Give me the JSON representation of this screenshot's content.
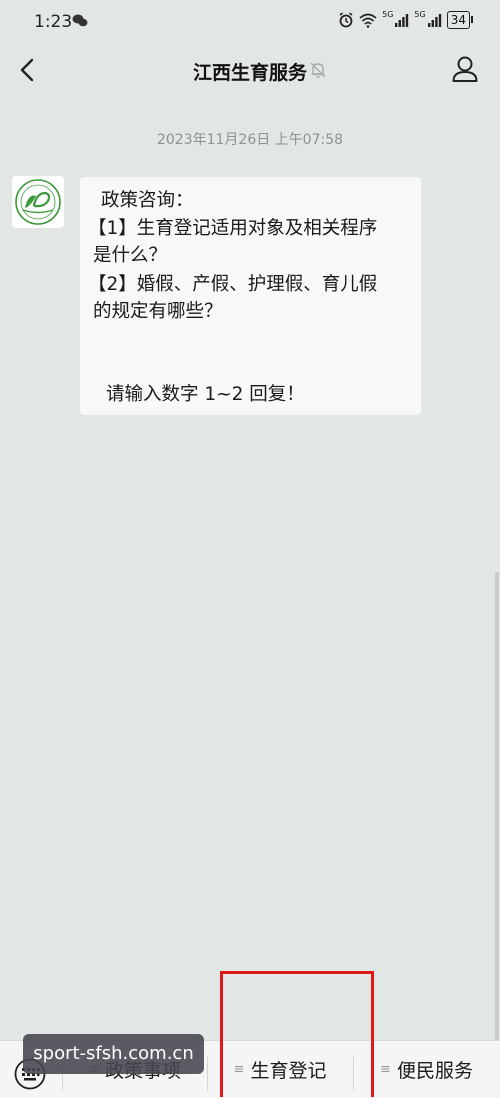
{
  "status_bar": {
    "time": "1:23",
    "signal_1": "5G",
    "signal_2": "5G",
    "battery": "34"
  },
  "nav": {
    "title": "江西生育服务"
  },
  "chat": {
    "timestamp": "2023年11月26日 上午07:58",
    "message_lines": [
      "政策咨询：",
      "【1】生育登记适用对象及相关程序",
      "是什么？",
      "【2】婚假、产假、护理假、育儿假",
      "的规定有哪些？",
      "",
      "请输入数字 1~2 回复！"
    ]
  },
  "menu": {
    "items": [
      {
        "label": "政策事项"
      },
      {
        "label": "生育登记"
      },
      {
        "label": "便民服务"
      }
    ],
    "highlight_color": "#e01818"
  },
  "watermark": {
    "text": "sport-sfsh.com.cn"
  },
  "colors": {
    "background": "#e2e7e6",
    "bubble": "#f8f8f8",
    "menu_bar": "#f5f5f5",
    "logo_green": "#3d9a3a"
  }
}
